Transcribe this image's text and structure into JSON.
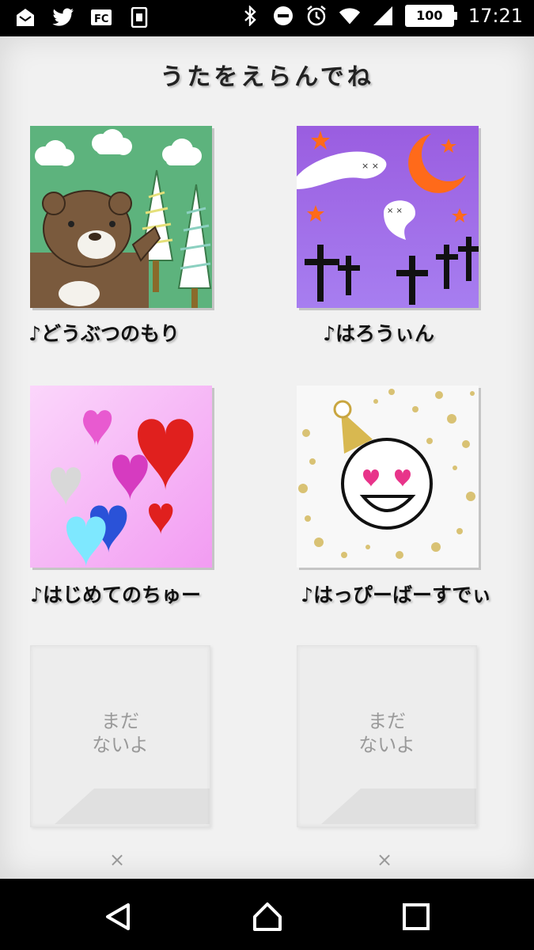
{
  "status_bar": {
    "time": "17:21",
    "battery": "100",
    "left_icons": [
      "notification-icon",
      "twitter-icon",
      "fc-icon",
      "sim-icon"
    ],
    "right_icons": [
      "bluetooth-icon",
      "do-not-disturb-icon",
      "alarm-icon",
      "wifi-icon",
      "signal-icon"
    ]
  },
  "header": {
    "title": "うたをえらんでね"
  },
  "songs": [
    {
      "label": "♪どうぶつのもり",
      "thumbnail": "bear-forest"
    },
    {
      "label": "♪はろうぃん",
      "thumbnail": "halloween-ghosts"
    },
    {
      "label": "♪はじめてのちゅー",
      "thumbnail": "glitter-hearts"
    },
    {
      "label": "♪はっぴーばーすでぃ",
      "thumbnail": "party-smiley"
    }
  ],
  "empty_slots": [
    {
      "label_line1": "まだ",
      "label_line2": "ないよ",
      "close": "×"
    },
    {
      "label_line1": "まだ",
      "label_line2": "ないよ",
      "close": "×"
    }
  ],
  "nav": {
    "back": "back-icon",
    "home": "home-icon",
    "recents": "recents-icon"
  },
  "colors": {
    "forest_green": "#5db37d",
    "halloween_purple": "#9a5de0",
    "pink": "#f3a4f4",
    "app_bg": "#f1f1f1"
  }
}
